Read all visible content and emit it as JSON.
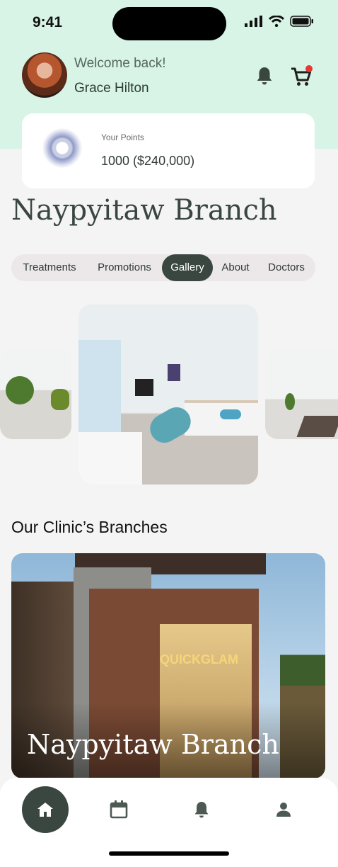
{
  "status_bar": {
    "time": "9:41"
  },
  "header": {
    "welcome": "Welcome back!",
    "user_name": "Grace Hilton"
  },
  "points": {
    "label": "Your Points",
    "value": "1000 ($240,000)"
  },
  "branch": {
    "title": "Naypyitaw Branch"
  },
  "tabs": [
    {
      "label": "Treatments",
      "active": false
    },
    {
      "label": "Promotions",
      "active": false
    },
    {
      "label": "Gallery",
      "active": true
    },
    {
      "label": "About",
      "active": false
    },
    {
      "label": "Doctors",
      "active": false
    }
  ],
  "branches_section": {
    "title": "Our Clinic’s Branches",
    "cards": [
      {
        "title": "Naypyitaw Branch",
        "sign": "QUICKGLAM"
      }
    ]
  },
  "colors": {
    "accent": "#3a4741",
    "header_bg": "#d7f4e6",
    "notification_dot": "#e53935"
  },
  "icons": {
    "bottom_nav": [
      "home-icon",
      "calendar-icon",
      "bell-icon",
      "profile-icon"
    ],
    "header": [
      "bell-icon",
      "cart-icon"
    ]
  }
}
